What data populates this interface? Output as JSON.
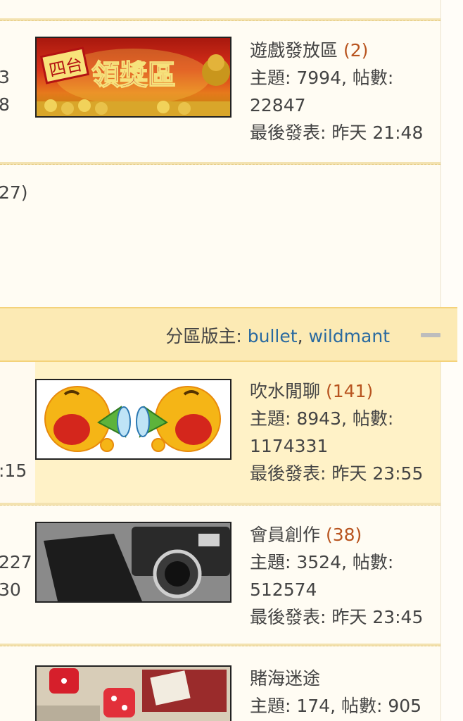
{
  "forums": [
    {
      "name": "遊戲發放區",
      "count": "(2)",
      "stats": "主題: 7994, 帖數:",
      "posts": "22847",
      "last": "最後發表: 昨天 21:48",
      "image": "四台領獎區 banner",
      "left_a": "3",
      "left_b": "8"
    },
    {
      "name": "吹水閒聊",
      "count": "(141)",
      "stats": "主題: 8943, 帖數:",
      "posts": "1174331",
      "last": "最後發表: 昨天 23:55",
      "image": "shouting smileys with megaphones",
      "left_a": ":15"
    },
    {
      "name": "會員創作",
      "count": "(38)",
      "stats": "主題: 3524, 帖數:",
      "posts": "512574",
      "last": "最後發表: 昨天 23:45",
      "image": "camera and notebook photo",
      "left_a": "227",
      "left_b": "30"
    },
    {
      "name": "賭海迷途",
      "stats": "主題: 174, 帖數: 905",
      "image": "dice and cards photo"
    }
  ],
  "partial_count": "27)",
  "section": {
    "mods_label": "分區版主: ",
    "mods": [
      "bullet",
      "wildmant"
    ],
    "sep": ", "
  },
  "colors": {
    "accent": "#b8541f",
    "link": "#2a6aa0",
    "header_bg": "#fceab4"
  }
}
